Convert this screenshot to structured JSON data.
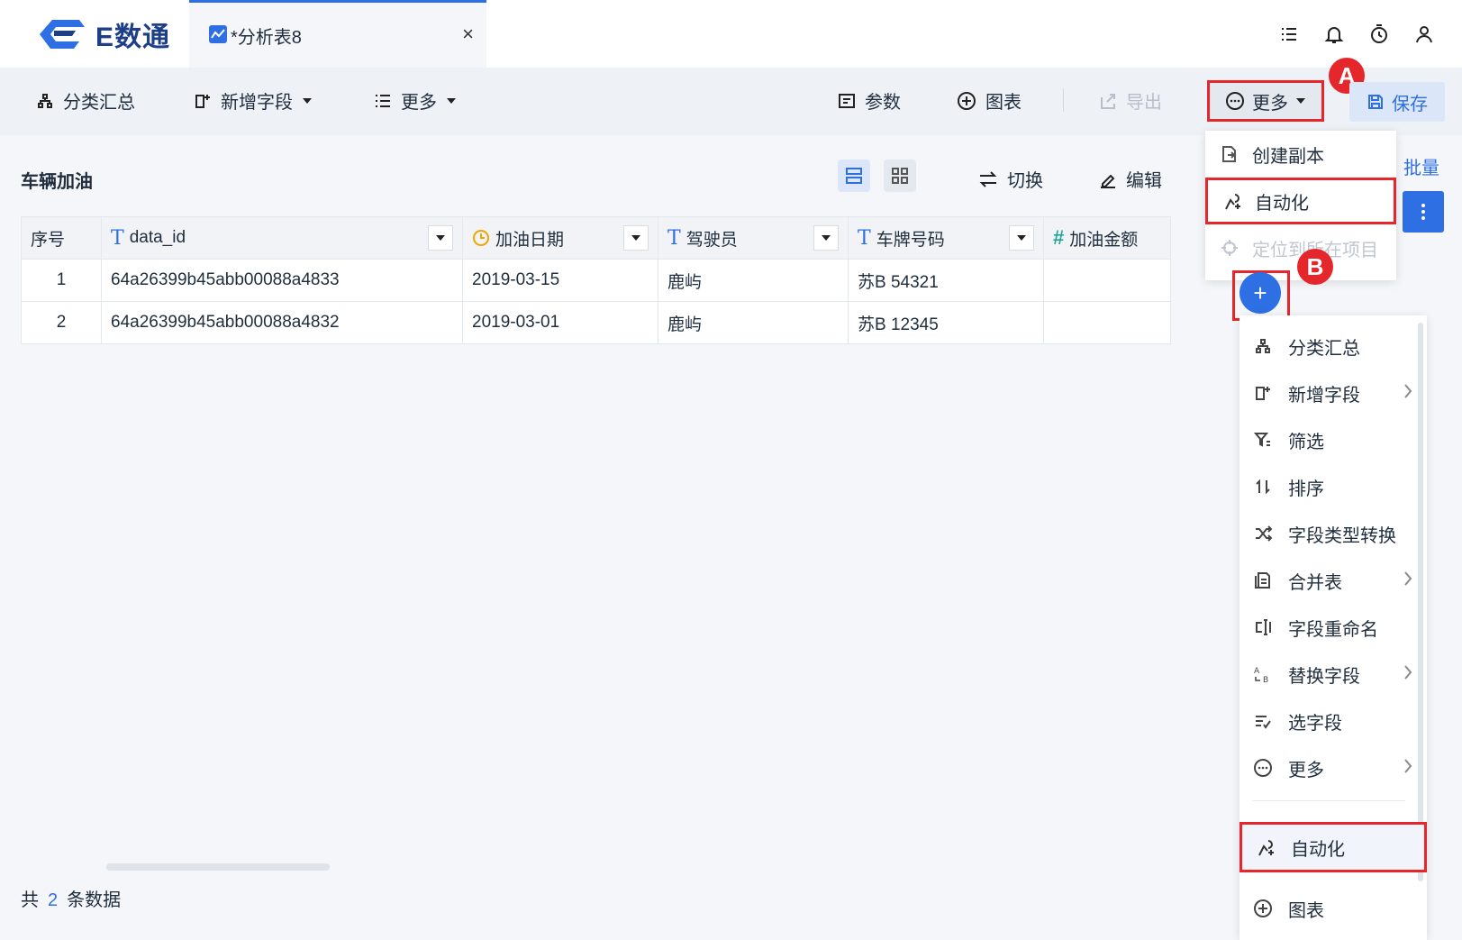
{
  "app": {
    "logo_text": "E数通"
  },
  "tab": {
    "label": "*分析表8",
    "close_glyph": "×"
  },
  "toolbar": {
    "group_summary": "分类汇总",
    "add_field": "新增字段",
    "more": "更多",
    "params": "参数",
    "chart": "图表",
    "export": "导出",
    "more_right": "更多",
    "save": "保存"
  },
  "badges": {
    "a": "A",
    "b": "B"
  },
  "content": {
    "title": "车辆加油",
    "switch": "切换",
    "edit": "编辑",
    "batch": "批量"
  },
  "table": {
    "headers": [
      "序号",
      "data_id",
      "加油日期",
      "驾驶员",
      "车牌号码",
      "加油金额"
    ],
    "rows": [
      [
        "1",
        "64a26399b45abb00088a4833",
        "2019-03-15",
        "鹿屿",
        "苏B 54321",
        ""
      ],
      [
        "2",
        "64a26399b45abb00088a4832",
        "2019-03-01",
        "鹿屿",
        "苏B 12345",
        ""
      ]
    ]
  },
  "footer": {
    "prefix": "共",
    "count": "2",
    "suffix": "条数据"
  },
  "dropdown_more": {
    "items": [
      {
        "label": "创建副本",
        "icon": "copy-icon"
      },
      {
        "label": "自动化",
        "icon": "automation-icon"
      },
      {
        "label": "定位到所在项目",
        "icon": "locate-icon"
      }
    ]
  },
  "plus_button": {
    "glyph": "+"
  },
  "side_menu": {
    "items": [
      {
        "label": "分类汇总",
        "icon": "hierarchy-icon"
      },
      {
        "label": "新增字段",
        "icon": "add-field-icon"
      },
      {
        "label": "筛选",
        "icon": "filter-icon"
      },
      {
        "label": "排序",
        "icon": "sort-icon"
      },
      {
        "label": "字段类型转换",
        "icon": "shuffle-icon"
      },
      {
        "label": "合并表",
        "icon": "merge-icon"
      },
      {
        "label": "字段重命名",
        "icon": "rename-icon"
      },
      {
        "label": "替换字段",
        "icon": "replace-icon"
      },
      {
        "label": "选字段",
        "icon": "select-fields-icon"
      },
      {
        "label": "更多",
        "icon": "more-icon"
      },
      {
        "label": "自动化",
        "icon": "automation-icon"
      },
      {
        "label": "图表",
        "icon": "chart-add-icon"
      }
    ]
  },
  "colors": {
    "accent": "#2f6fe4",
    "highlight": "#e5262b",
    "logo": "#1d3f86"
  }
}
